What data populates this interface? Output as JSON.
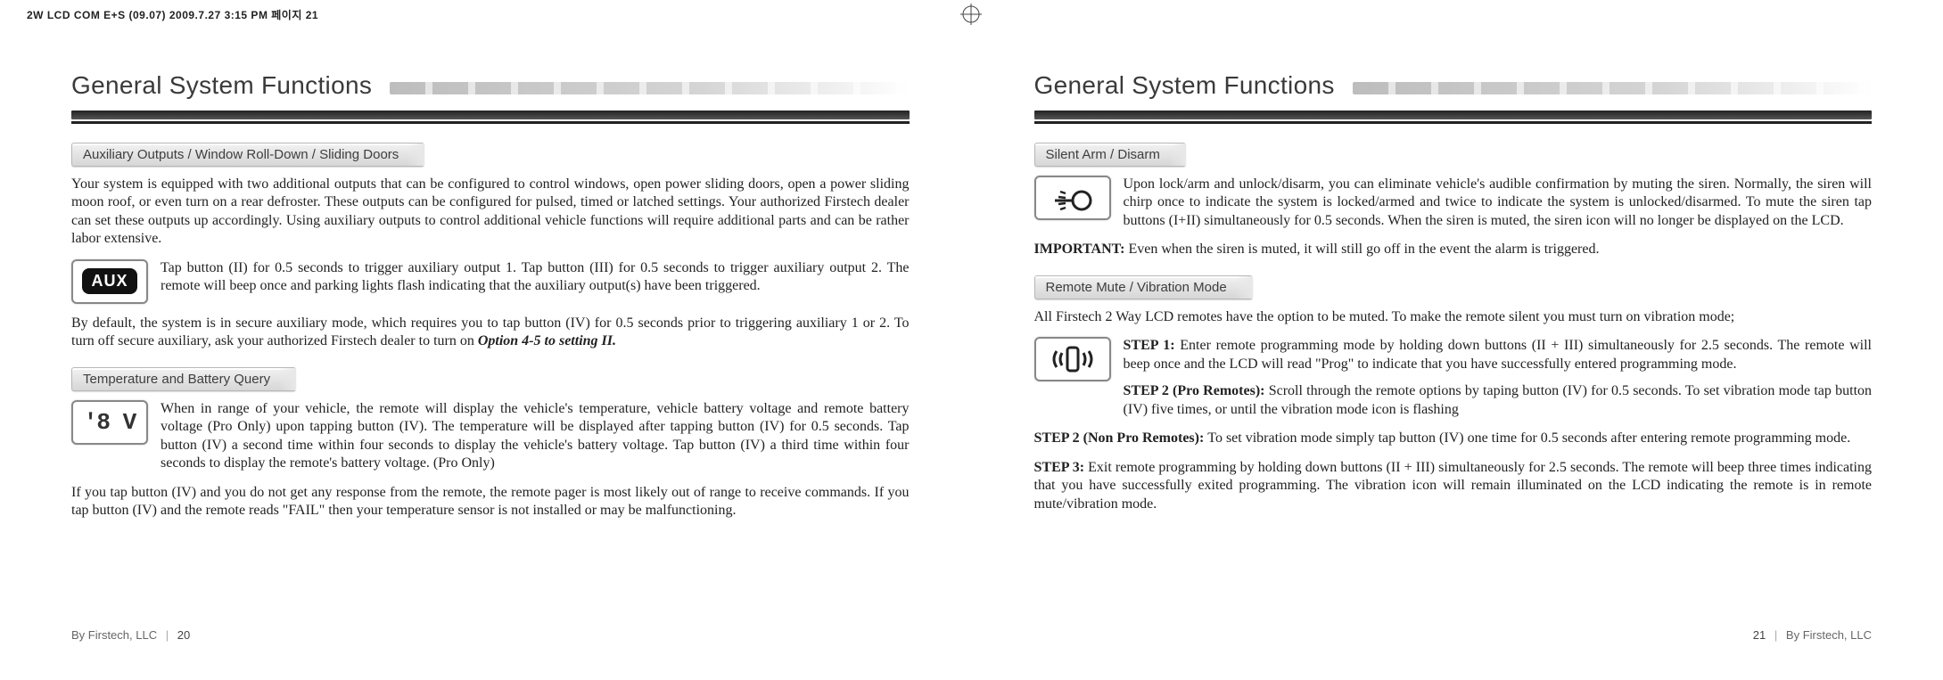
{
  "docHeader": "2W LCD COM E+S (09.07)  2009.7.27 3:15 PM  페이지 21",
  "left": {
    "title": "General System Functions",
    "sec1": {
      "tab": "Auxiliary Outputs / Window Roll-Down / Sliding Doors",
      "p1": "Your system is equipped with two additional outputs that can be configured to control windows, open power sliding doors, open a    power sliding moon roof, or even turn on a rear defroster. These outputs can be configured for pulsed, timed or latched settings. Your authorized Firstech dealer can set these outputs up accordingly. Using auxiliary outputs to control additional vehicle functions will require additional parts and can be rather labor extensive.",
      "iconLabel": "AUX",
      "p2": "Tap button (II) for 0.5 seconds to trigger auxiliary output 1. Tap button (III) for 0.5 seconds to trigger auxiliary output 2. The remote will beep once and parking lights flash indicating that the auxiliary output(s) have been triggered.",
      "p3a": "By default, the system is in secure auxiliary mode, which requires you to tap button (IV) for 0.5 seconds prior to triggering auxiliary 1 or 2. To turn off secure auxiliary, ask your authorized Firstech dealer to turn on ",
      "p3b": "Option 4-5 to setting II.",
      "p3c": ""
    },
    "sec2": {
      "tab": "Temperature and Battery Query",
      "iconLabel": "'8 V",
      "p1": "When in range of your vehicle, the remote will display the vehicle's temperature, vehicle battery voltage and remote battery voltage (Pro Only) upon tapping button (IV). The temperature will be displayed after tapping button (IV) for 0.5 seconds. Tap button (IV) a second time within four seconds to display the vehicle's battery voltage. Tap button (IV) a third time within four seconds to display the remote's battery voltage. (Pro Only)",
      "p2": "If you tap button (IV) and you do not get any response from the remote, the remote pager is most likely out of range to receive commands. If you tap button (IV) and the remote reads \"FAIL\" then your temperature sensor is not installed or may be malfunctioning."
    },
    "footerBrand": "By Firstech, LLC",
    "footerPage": "20"
  },
  "right": {
    "title": "General System Functions",
    "sec1": {
      "tab": "Silent Arm / Disarm",
      "p1": "Upon lock/arm and unlock/disarm, you can eliminate vehicle's audible confirmation by muting the siren. Normally, the siren will chirp once to indicate the system is locked/armed and twice to indicate the system is unlocked/disarmed. To mute the siren tap buttons (I+II) simultaneously for 0.5 seconds. When the siren is muted, the siren icon will no longer be displayed on the LCD.",
      "importantLead": "IMPORTANT: ",
      "importantBody": "Even when the siren is muted, it will still go off in the event the alarm is triggered."
    },
    "sec2": {
      "tab": "Remote Mute / Vibration Mode",
      "intro": "All Firstech 2 Way LCD remotes have the option to be muted. To make the remote silent you must turn on vibration mode;",
      "step1Lead": "STEP 1: ",
      "step1": "Enter remote programming mode by holding down buttons (II + III) simultaneously for 2.5 seconds. The remote will beep once and the LCD will read \"Prog\" to indicate that you have successfully entered programming mode.",
      "step2proLead": "STEP 2 (Pro Remotes): ",
      "step2pro": "Scroll through the remote options by taping button (IV) for 0.5 seconds. To set vibration mode tap button (IV) five times, or until the vibration mode icon is flashing",
      "step2nonLead": "STEP 2 (Non Pro Remotes): ",
      "step2non": "To set vibration mode simply tap button (IV) one time for 0.5 seconds after entering remote programming mode.",
      "step3Lead": "STEP 3: ",
      "step3": "Exit remote programming by holding down buttons (II + III) simultaneously for 2.5 seconds. The remote will beep three times indicating that you have successfully exited programming. The vibration icon will remain illuminated on the LCD indicating the remote is in remote mute/vibration mode."
    },
    "footerBrand": "By Firstech, LLC",
    "footerPage": "21"
  }
}
